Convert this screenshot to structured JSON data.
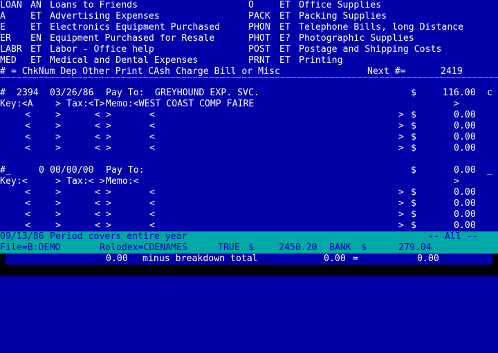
{
  "categories_left": [
    {
      "code": "LOAN",
      "type": "AN",
      "desc": "Loans to Friends"
    },
    {
      "code": "A",
      "type": "ET",
      "desc": "Advertising Expenses"
    },
    {
      "code": "E",
      "type": "ET",
      "desc": "Electronics Equipment Purchased"
    },
    {
      "code": "ER",
      "type": "EN",
      "desc": "Equipment Purchased for Resale"
    },
    {
      "code": "LABR",
      "type": "ET",
      "desc": "Labor - Office help"
    },
    {
      "code": "MED",
      "type": "ET",
      "desc": "Medical and Dental Expenses"
    }
  ],
  "categories_right": [
    {
      "code": "O",
      "type": "ET",
      "desc": "Office Supplies"
    },
    {
      "code": "PACK",
      "type": "ET",
      "desc": "Packing Supplies"
    },
    {
      "code": "PHON",
      "type": "ET",
      "desc": "Telephone Bills, long Distance"
    },
    {
      "code": "PHOT",
      "type": "E?",
      "desc": "Photographic Supplies"
    },
    {
      "code": "POST",
      "type": "ET",
      "desc": "Postage and Shipping Costs"
    },
    {
      "code": "PRNT",
      "type": "ET",
      "desc": "Printing"
    }
  ],
  "legend": "# = ChkNum Dep Other Print CAsh Charge Bill or Misc",
  "next_label": "Next #=",
  "next_value": "2419",
  "separator": "================================================================================================================",
  "entry1": {
    "hash": "#",
    "num": "2394",
    "date": "03/26/86",
    "payto_label": "Pay To:",
    "payee": "GREYHOUND EXP. SVC.",
    "dollar": "$",
    "amount": "116.00",
    "flag": "c",
    "key_label": "Key:<A",
    "gt": ">",
    "tax_label": "Tax:<T>",
    "memo_label": "Memo:<WEST COAST COMP FAIRE",
    "zero": "0.00"
  },
  "entry2": {
    "hash": "#_",
    "num": "0",
    "date": "00/00/00",
    "payto_label": "Pay To:",
    "dollar": "$",
    "amount": "0.00",
    "flag": "_",
    "key_label": "Key:<",
    "gt": ">",
    "tax_label": "Tax:< >",
    "memo_label": "Memo:<",
    "zero": "0.00"
  },
  "split": {
    "lt": "<",
    "gt": ">",
    "pair": "< >",
    "dollar": "$"
  },
  "status1": {
    "date": "09/13/86",
    "text": "Period covers entire year",
    "right": "-- All --"
  },
  "status2": {
    "file": "File=B:DEMO",
    "rolodex": "Rolodex=CDENAMES",
    "flag": "TRUE",
    "dollar1": "$",
    "amount1": "2450.20",
    "bank": "BANK",
    "dollar2": "$",
    "amount2": "279.04"
  },
  "status3": {
    "a": "0.00",
    "text": "minus breakdown total",
    "b": "0.00",
    "eq": "=",
    "c": "0.00"
  },
  "colors": {
    "background": "#0000a8",
    "foreground": "#ffffff",
    "status_bar": "#00a8a8",
    "status_text": "#0000a8",
    "bottom_bar": "#000000"
  }
}
